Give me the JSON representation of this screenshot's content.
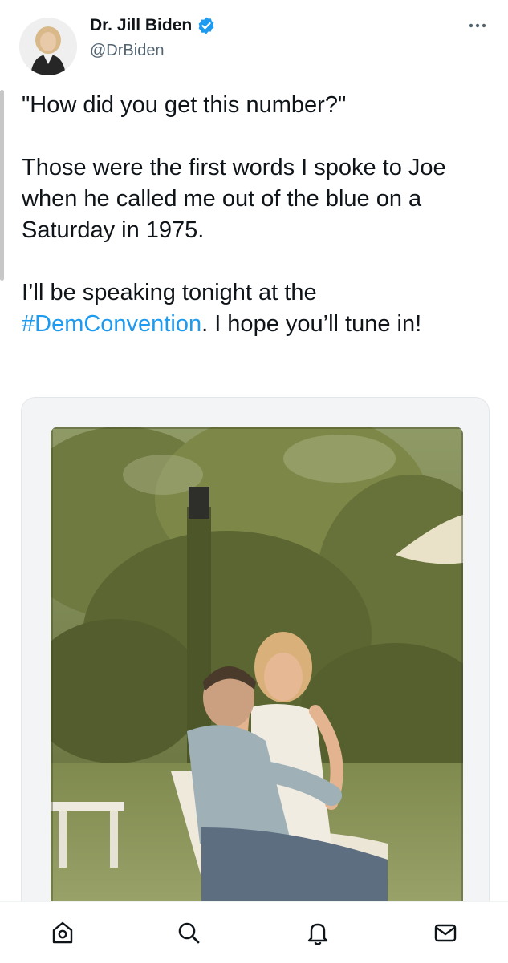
{
  "tweet": {
    "author": {
      "display_name": "Dr. Jill Biden",
      "handle": "@DrBiden",
      "verified": true
    },
    "text": {
      "line1": "\"How did you get this number?\"",
      "para2": "Those were the first words I spoke to Joe when he called me out of the blue on a Saturday in 1975.",
      "para3_before": "I’ll be speaking tonight at the ",
      "hashtag": "#DemConvention",
      "para3_after": ". I hope you’ll tune in!"
    }
  },
  "icons": {
    "more": "more-horizontal-icon",
    "verified": "verified-badge-icon",
    "home": "home-icon",
    "search": "search-icon",
    "notifications": "bell-icon",
    "messages": "mail-icon"
  },
  "colors": {
    "link": "#1d9bf0",
    "text": "#0f1419",
    "secondary": "#536471"
  }
}
